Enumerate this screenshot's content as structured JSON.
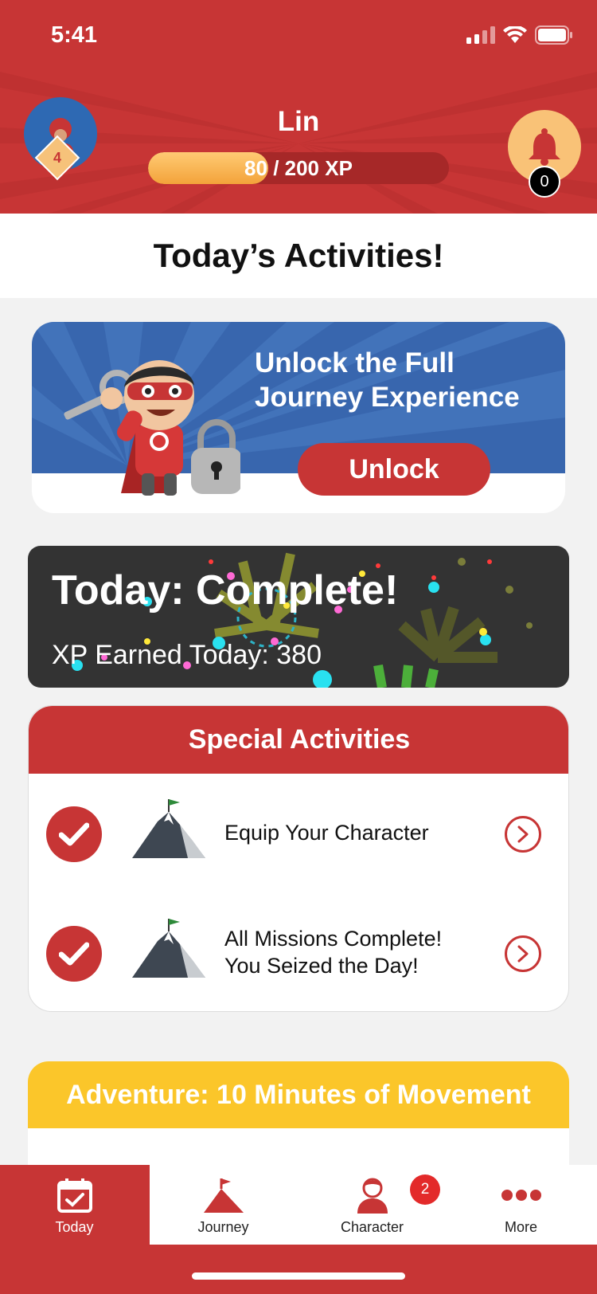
{
  "status": {
    "time": "5:41"
  },
  "profile": {
    "name": "Lin",
    "level": "4",
    "xp_text": "80 / 200 XP",
    "xp_current": 80,
    "xp_max": 200
  },
  "notifications": {
    "count": "0"
  },
  "page": {
    "title": "Today’s Activities!"
  },
  "unlock": {
    "title_line1": "Unlock the Full",
    "title_line2": "Journey Experience",
    "button_label": "Unlock"
  },
  "complete": {
    "title": "Today: Complete!",
    "xp_text": "XP Earned Today: 380"
  },
  "special": {
    "header": "Special Activities",
    "items": [
      {
        "line1": "Equip Your Character",
        "line2": ""
      },
      {
        "line1": "All Missions Complete!",
        "line2": "You Seized the Day!"
      }
    ]
  },
  "adventure": {
    "header": "Adventure: 10 Minutes of Movement"
  },
  "tabs": [
    {
      "label": "Today",
      "icon": "calendar-check-icon"
    },
    {
      "label": "Journey",
      "icon": "mountain-flag-icon"
    },
    {
      "label": "Character",
      "icon": "person-icon",
      "badge": "2"
    },
    {
      "label": "More",
      "icon": "more-dots-icon"
    }
  ],
  "colors": {
    "brand_red": "#c73535",
    "blue": "#3866ae",
    "gold": "#fbc62a",
    "xp_orange": "#f3a33a"
  }
}
